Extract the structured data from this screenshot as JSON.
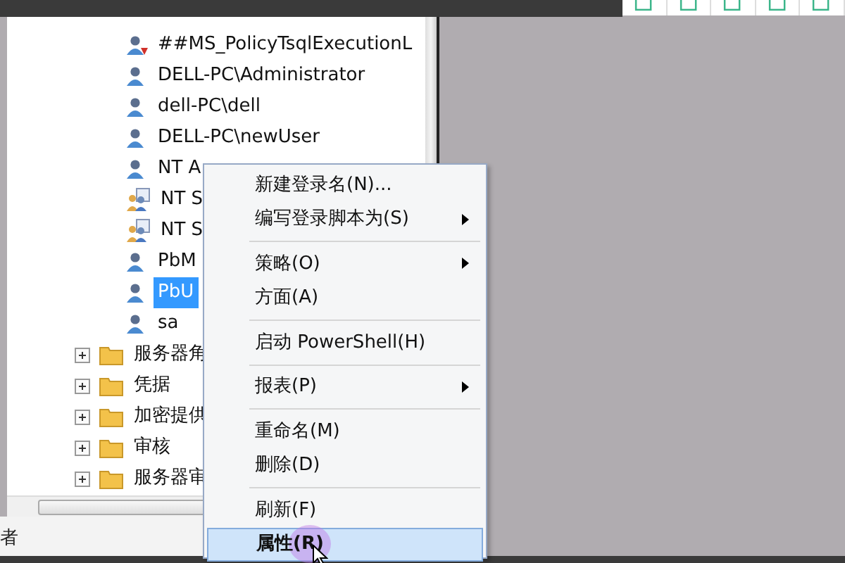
{
  "logins": [
    {
      "label": "##MS_PolicyTsqlExecutionL",
      "kind": "login-disabled",
      "selected": false
    },
    {
      "label": "DELL-PC\\Administrator",
      "kind": "login",
      "selected": false
    },
    {
      "label": "dell-PC\\dell",
      "kind": "login",
      "selected": false
    },
    {
      "label": "DELL-PC\\newUser",
      "kind": "login",
      "selected": false
    },
    {
      "label": "NT A",
      "kind": "login",
      "selected": false
    },
    {
      "label": "NT S",
      "kind": "group",
      "selected": false
    },
    {
      "label": "NT S",
      "kind": "group",
      "selected": false
    },
    {
      "label": "PbM",
      "kind": "login",
      "selected": false
    },
    {
      "label": "PbU",
      "kind": "login",
      "selected": true
    },
    {
      "label": "sa",
      "kind": "login",
      "selected": false
    }
  ],
  "folders": [
    {
      "label": "服务器角",
      "expanded": false
    },
    {
      "label": "凭据",
      "expanded": false
    },
    {
      "label": "加密提供",
      "expanded": false
    },
    {
      "label": "审核",
      "expanded": false
    },
    {
      "label": "服务器审",
      "expanded": false
    }
  ],
  "status_bar": {
    "text": "者"
  },
  "context_menu": [
    {
      "label": "新建登录名(N)...",
      "submenu": false,
      "separator_before": false,
      "selected": false,
      "default": false
    },
    {
      "label": "编写登录脚本为(S)",
      "submenu": true,
      "separator_before": false,
      "selected": false,
      "default": false
    },
    {
      "label": "策略(O)",
      "submenu": true,
      "separator_before": true,
      "selected": false,
      "default": false
    },
    {
      "label": "方面(A)",
      "submenu": false,
      "separator_before": false,
      "selected": false,
      "default": false
    },
    {
      "label": "启动 PowerShell(H)",
      "submenu": false,
      "separator_before": true,
      "selected": false,
      "default": false
    },
    {
      "label": "报表(P)",
      "submenu": true,
      "separator_before": true,
      "selected": false,
      "default": false
    },
    {
      "label": "重命名(M)",
      "submenu": false,
      "separator_before": true,
      "selected": false,
      "default": false
    },
    {
      "label": "删除(D)",
      "submenu": false,
      "separator_before": false,
      "selected": false,
      "default": false
    },
    {
      "label": "刷新(F)",
      "submenu": false,
      "separator_before": true,
      "selected": false,
      "default": false
    },
    {
      "label": "属性(R)",
      "submenu": false,
      "separator_before": false,
      "selected": true,
      "default": true
    }
  ]
}
